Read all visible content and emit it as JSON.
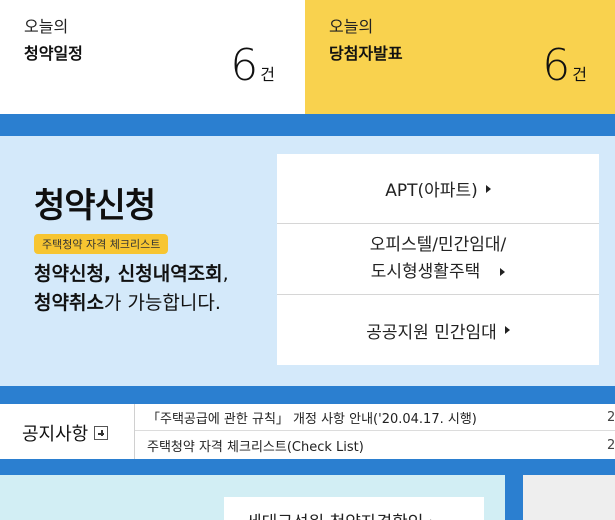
{
  "today_schedule": {
    "label_small": "오늘의",
    "label_big": "청약일정",
    "count": "6",
    "unit": "건"
  },
  "today_winner": {
    "label_small": "오늘의",
    "label_big": "당첨자발표",
    "count": "6",
    "unit": "건"
  },
  "apply": {
    "title": "청약신청",
    "checklist_tag": "주택청약 자격 체크리스트",
    "desc_bold1": "청약신청",
    "desc_mid": ", ",
    "desc_bold2": "신청내역조회",
    "desc_end1": ",",
    "desc_bold3": "청약취소",
    "desc_end2": "가 가능합니다."
  },
  "menu": {
    "item1": "APT(아파트)",
    "item2_line1": "오피스텔/민간임대/",
    "item2_line2": "도시형생활주택",
    "item3": "공공지원 민간임대"
  },
  "notice": {
    "title": "공지사항",
    "rows": [
      {
        "text": "「주택공급에 관한 규칙」 개정 사항 안내('20.04.17. 시행)",
        "date": "2"
      },
      {
        "text": "주택청약 자격 체크리스트(Check List)",
        "date": "2"
      }
    ]
  },
  "bottom": {
    "card_text": "세대구성원 청약자격확인 ›"
  },
  "colors": {
    "yellow": "#f9d24e",
    "blue": "#2b7fd0",
    "light_blue": "#d4e9fa",
    "tag": "#f7c531"
  }
}
